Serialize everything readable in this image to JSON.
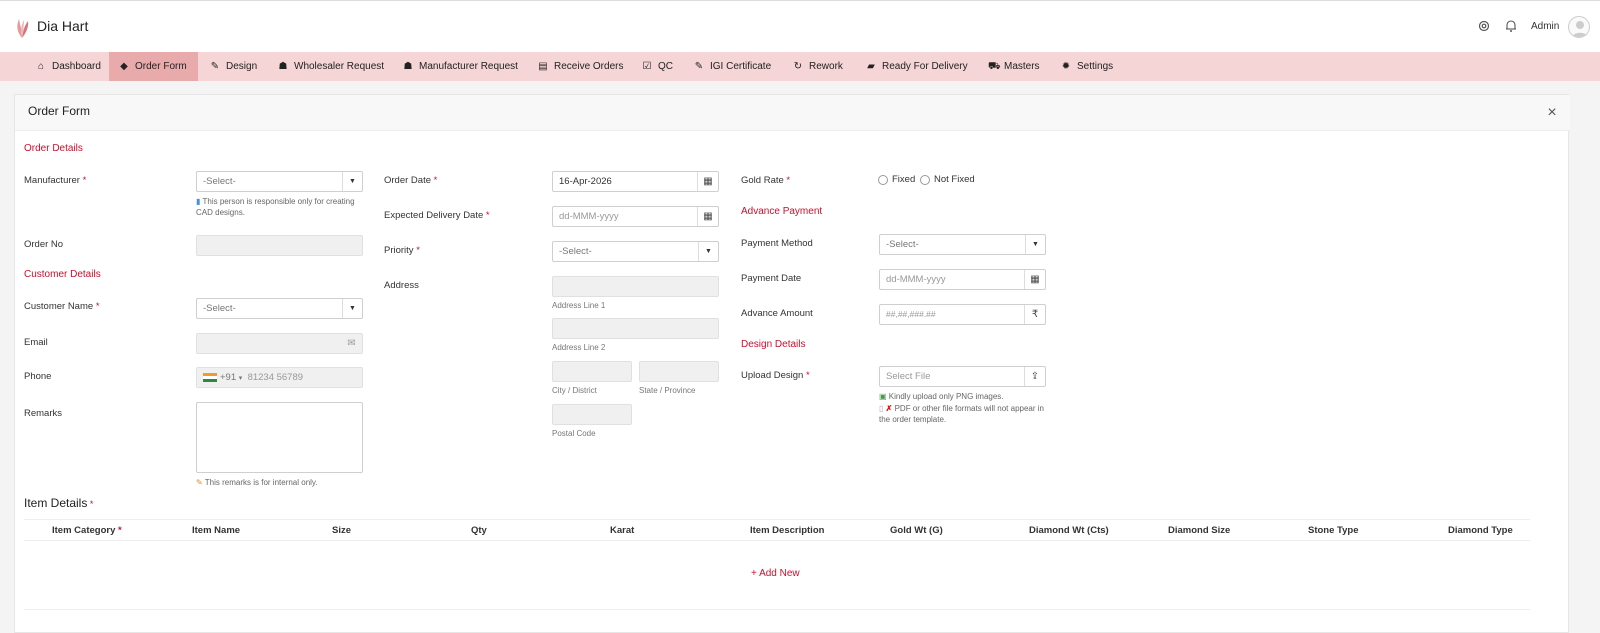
{
  "brand": {
    "name": "Dia Hart"
  },
  "header": {
    "settings_icon": "gear-icon",
    "notifications_icon": "bell-icon",
    "user": "Admin"
  },
  "nav": [
    {
      "label": "Dashboard",
      "icon": "home-icon"
    },
    {
      "label": "Order Form",
      "icon": "tag-icon",
      "active": true
    },
    {
      "label": "Design",
      "icon": "design-icon"
    },
    {
      "label": "Wholesaler Request",
      "icon": "people-icon"
    },
    {
      "label": "Manufacturer Request",
      "icon": "people-icon"
    },
    {
      "label": "Receive Orders",
      "icon": "list-icon"
    },
    {
      "label": "QC",
      "icon": "check-icon"
    },
    {
      "label": "IGI Certificate",
      "icon": "certificate-icon"
    },
    {
      "label": "Rework",
      "icon": "refresh-icon"
    },
    {
      "label": "Ready For Delivery",
      "icon": "truck-icon"
    },
    {
      "label": "Masters",
      "icon": "cart-icon"
    },
    {
      "label": "Settings",
      "icon": "gear-icon"
    }
  ],
  "panel": {
    "title": "Order Form"
  },
  "order_details": {
    "title": "Order Details",
    "manufacturer_label": "Manufacturer",
    "manufacturer_value": "-Select-",
    "manufacturer_hint": "This person is responsible only for creating CAD designs.",
    "order_no_label": "Order No"
  },
  "customer_details": {
    "title": "Customer Details",
    "customer_name_label": "Customer Name",
    "customer_name_value": "-Select-",
    "email_label": "Email",
    "phone_label": "Phone",
    "phone_code": "+91",
    "phone_placeholder": "81234 56789",
    "remarks_label": "Remarks",
    "remarks_hint": "This remarks is for internal only."
  },
  "order_info": {
    "order_date_label": "Order Date",
    "order_date_value": "16-Apr-2026",
    "delivery_date_label": "Expected Delivery Date",
    "delivery_date_placeholder": "dd-MMM-yyyy",
    "priority_label": "Priority",
    "priority_value": "-Select-",
    "address_label": "Address",
    "address_line1": "Address Line 1",
    "address_line2": "Address Line 2",
    "city": "City / District",
    "state": "State / Province",
    "postal": "Postal Code"
  },
  "gold": {
    "label": "Gold Rate",
    "opt1": "Fixed",
    "opt2": "Not Fixed"
  },
  "advance_payment": {
    "title": "Advance Payment",
    "method_label": "Payment Method",
    "method_value": "-Select-",
    "date_label": "Payment Date",
    "date_placeholder": "dd-MMM-yyyy",
    "amount_label": "Advance Amount",
    "amount_placeholder": "##,##,###.##",
    "currency": "₹"
  },
  "design_details": {
    "title": "Design Details",
    "upload_label": "Upload Design",
    "upload_placeholder": "Select File",
    "hint1": "Kindly upload only PNG images.",
    "hint2": "PDF or other file formats will not appear in the order template."
  },
  "items": {
    "title": "Item Details",
    "columns": [
      "Item Category",
      "Item Name",
      "Size",
      "Qty",
      "Karat",
      "Item Description",
      "Gold Wt (G)",
      "Diamond Wt (Cts)",
      "Diamond Size",
      "Stone Type",
      "Diamond Type"
    ],
    "add_new": "+ Add New"
  }
}
